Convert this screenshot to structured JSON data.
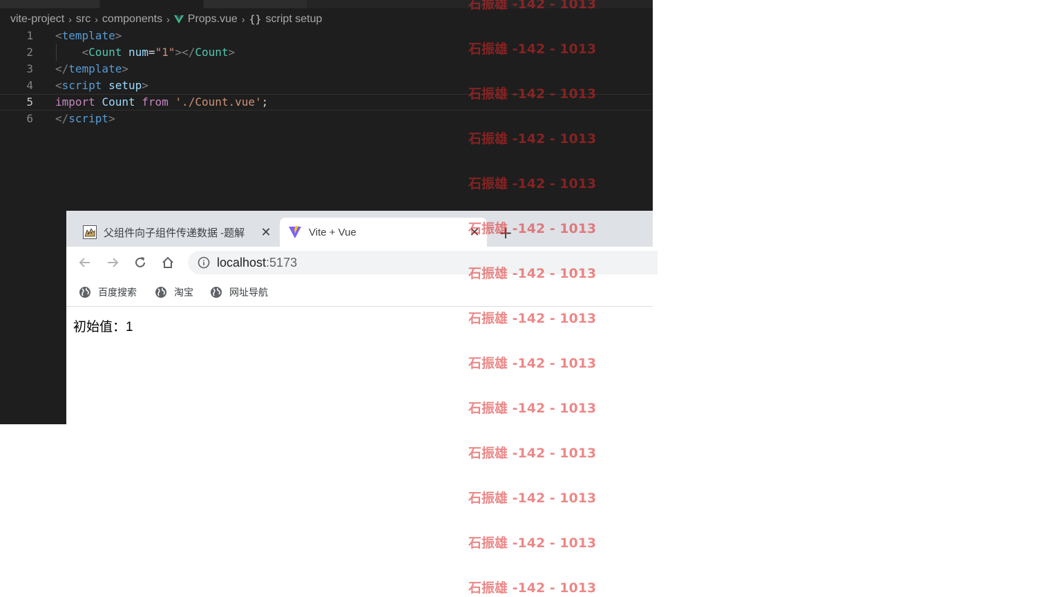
{
  "editor": {
    "breadcrumb": {
      "items": [
        "vite-project",
        "src",
        "components",
        "Props.vue",
        "script setup"
      ],
      "separator": "›",
      "braces": "{}"
    },
    "lines": [
      {
        "num": "1",
        "tokens": [
          [
            "punc",
            "<"
          ],
          [
            "tag",
            "template"
          ],
          [
            "punc",
            ">"
          ]
        ]
      },
      {
        "num": "2",
        "tokens": [
          [
            "plain",
            "    "
          ],
          [
            "punc",
            "<"
          ],
          [
            "comp",
            "Count"
          ],
          [
            "plain",
            " "
          ],
          [
            "attr",
            "num"
          ],
          [
            "plain",
            "="
          ],
          [
            "str",
            "\"1\""
          ],
          [
            "punc",
            "></"
          ],
          [
            "comp",
            "Count"
          ],
          [
            "punc",
            ">"
          ]
        ]
      },
      {
        "num": "3",
        "tokens": [
          [
            "punc",
            "</"
          ],
          [
            "tag",
            "template"
          ],
          [
            "punc",
            ">"
          ]
        ]
      },
      {
        "num": "4",
        "tokens": [
          [
            "punc",
            "<"
          ],
          [
            "tag",
            "script"
          ],
          [
            "plain",
            " "
          ],
          [
            "attr",
            "setup"
          ],
          [
            "punc",
            ">"
          ]
        ]
      },
      {
        "num": "5",
        "tokens": [
          [
            "kw",
            "import"
          ],
          [
            "plain",
            " "
          ],
          [
            "ident",
            "Count"
          ],
          [
            "plain",
            " "
          ],
          [
            "kw",
            "from"
          ],
          [
            "plain",
            " "
          ],
          [
            "str",
            "'./Count.vue'"
          ],
          [
            "plain",
            ";"
          ]
        ]
      },
      {
        "num": "6",
        "tokens": [
          [
            "punc",
            "</"
          ],
          [
            "tag",
            "script"
          ],
          [
            "punc",
            ">"
          ]
        ]
      }
    ],
    "current_line": 5,
    "colors": {
      "background": "#1e1e1e",
      "tag": "#569cd6",
      "component": "#4ec9b0",
      "string": "#ce9178",
      "keyword": "#c586c0"
    }
  },
  "browser": {
    "tabs": [
      {
        "title": "父组件向子组件传递数据 -题解",
        "close": "✕",
        "active": false,
        "icon": "cat-favicon-icon"
      },
      {
        "title": "Vite + Vue",
        "close": "✕",
        "active": true,
        "icon": "vite-favicon-icon"
      }
    ],
    "new_tab": "+",
    "url_host": "localhost",
    "url_port": ":5173",
    "bookmarks": [
      "百度搜索",
      "淘宝",
      "网址导航"
    ],
    "content_text": "初始值：1"
  },
  "watermark": {
    "text": "石振雄 -142 - 1013",
    "repeat": 14,
    "color": "#dc2626"
  }
}
